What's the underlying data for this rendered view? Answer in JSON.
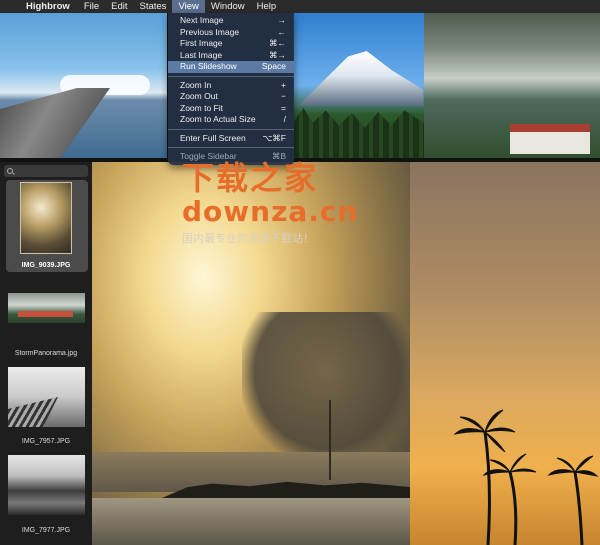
{
  "menubar": {
    "apple_icon": "",
    "app_name": "Highbrow",
    "menus": [
      "File",
      "Edit",
      "States",
      "View",
      "Window",
      "Help"
    ]
  },
  "view_menu": {
    "items": [
      {
        "label": "Next Image",
        "shortcut": "→"
      },
      {
        "label": "Previous Image",
        "shortcut": "←"
      },
      {
        "label": "First Image",
        "shortcut": "⌘←"
      },
      {
        "label": "Last Image",
        "shortcut": "⌘→"
      },
      {
        "label": "Run Slideshow",
        "shortcut": "Space"
      },
      {
        "label": "Zoom In",
        "shortcut": "+"
      },
      {
        "label": "Zoom Out",
        "shortcut": "−"
      },
      {
        "label": "Zoom to Fit",
        "shortcut": "="
      },
      {
        "label": "Zoom to Actual Size",
        "shortcut": "/"
      },
      {
        "label": "Enter Full Screen",
        "shortcut": "⌥⌘F"
      },
      {
        "label": "Toggle Sidebar",
        "shortcut": "⌘B"
      }
    ]
  },
  "sidebar": {
    "search_placeholder": "",
    "thumbnails": [
      {
        "filename": "IMG_9039.JPG"
      },
      {
        "filename": "StormPanorama.jpg"
      },
      {
        "filename": "IMG_7957.JPG"
      },
      {
        "filename": "IMG_7977.JPG"
      }
    ]
  },
  "watermark": {
    "line1": "下载之家",
    "line2": "downza.cn",
    "line3": "国内最专业的资源下载站！"
  }
}
